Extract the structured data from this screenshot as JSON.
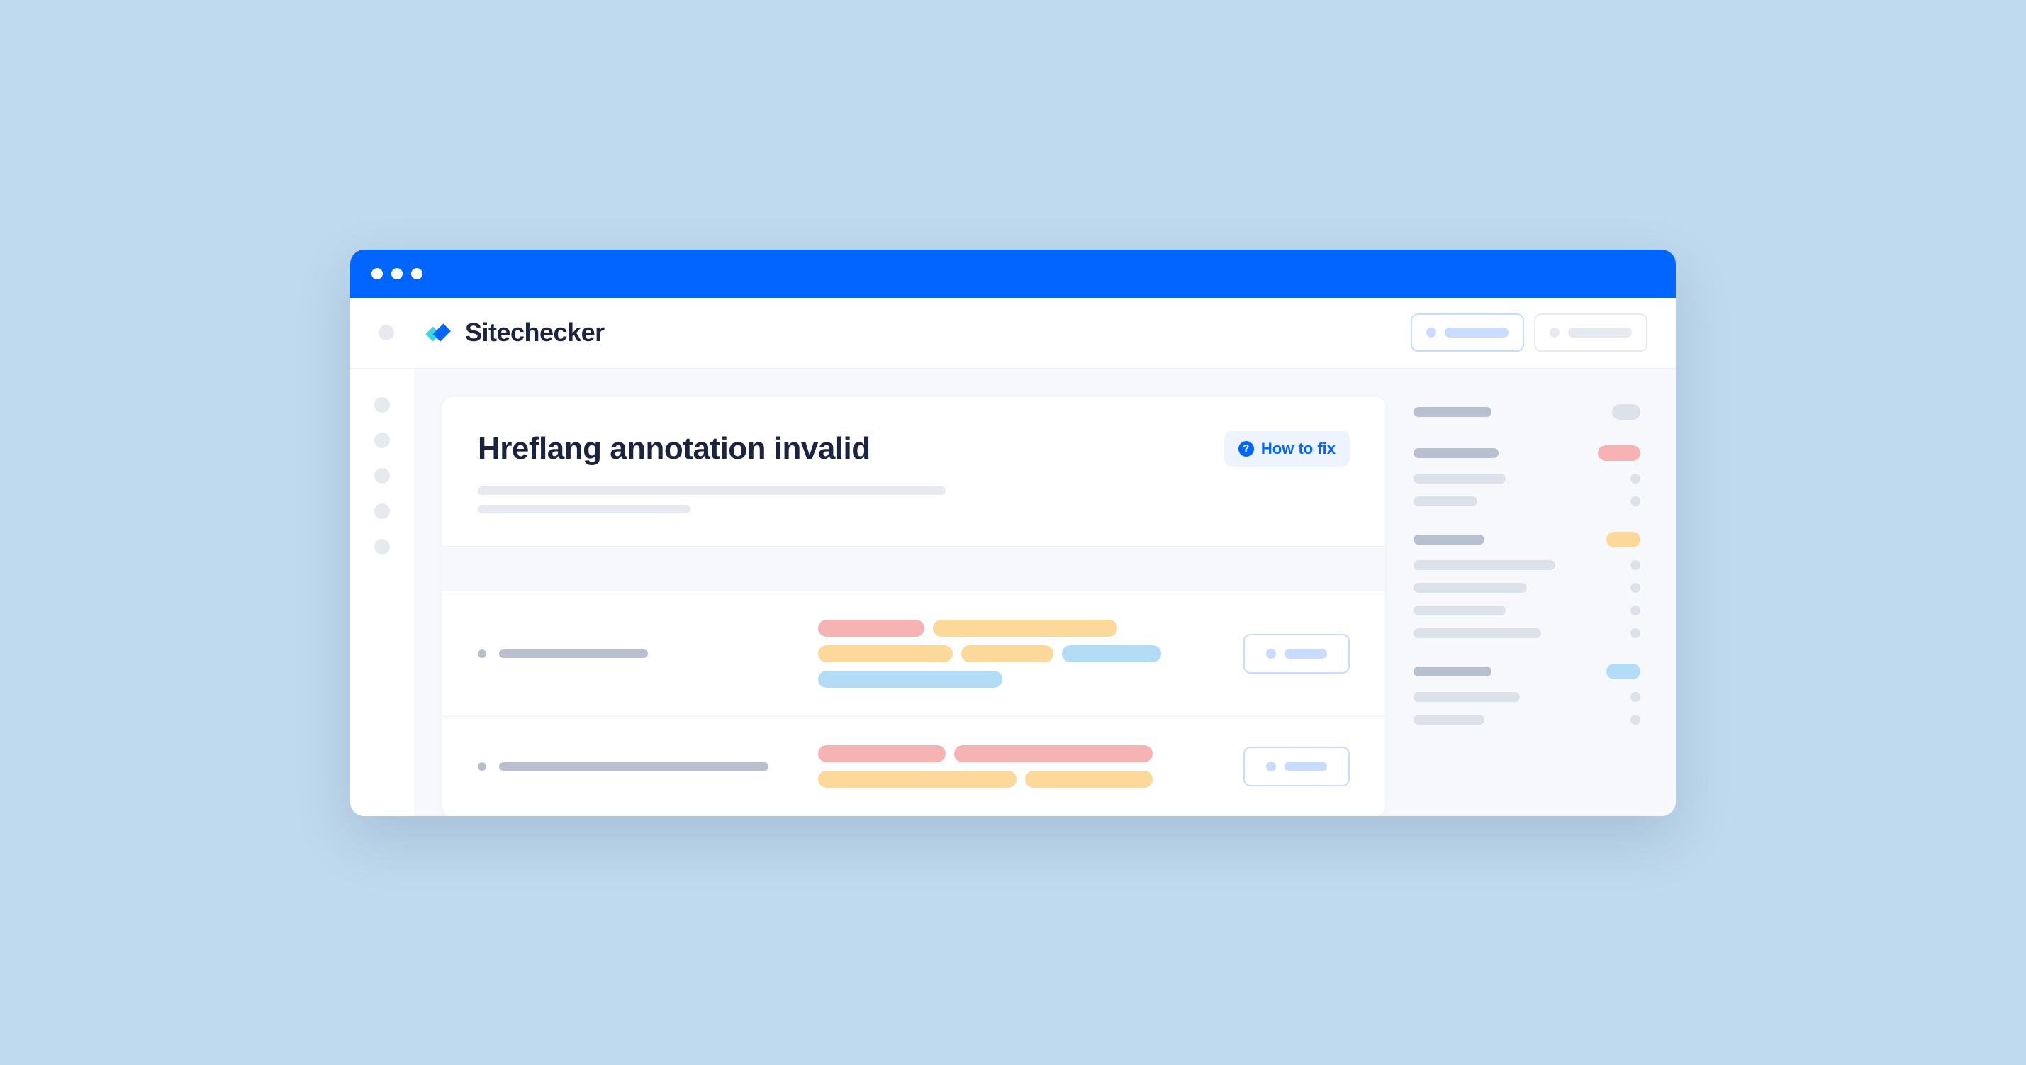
{
  "brand": {
    "name": "Sitechecker"
  },
  "page": {
    "title": "Hreflang annotation invalid",
    "howto_label": "How to fix"
  }
}
